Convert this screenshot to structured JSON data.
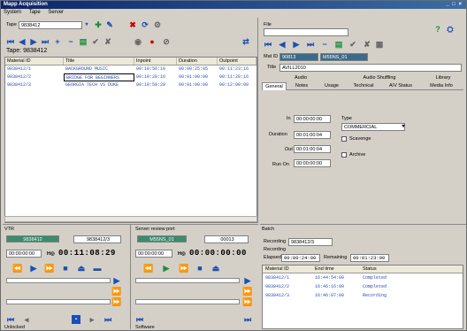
{
  "app": {
    "title": "Mapp Acquisition",
    "window_controls": "_ □ ×"
  },
  "menu": {
    "items": [
      "System",
      "Tape",
      "Server"
    ]
  },
  "left": {
    "tape_label": "Tape",
    "tape_value": "9838412",
    "tape_heading": "Tape: 9838412",
    "columns": [
      "Material ID",
      "Title",
      "Inpoint",
      "Duration",
      "Outpoint"
    ],
    "rows": [
      {
        "id": "9838412/1",
        "title": "BACKGROUND MUSIC",
        "in": "00:10:56:10",
        "dur": "00:00:25:05",
        "out": "00:11:23:16"
      },
      {
        "id": "9838412/2",
        "title": "BRIDGE FOR BEGINNERS",
        "in": "00:10:28:16",
        "dur": "00:01:00:00",
        "out": "00:11:28:16"
      },
      {
        "id": "9838412/3",
        "title": "GEORGIA TECH VS DUKE",
        "in": "00:10:59:29",
        "dur": "00:01:00:00",
        "out": "00:12:00:00"
      }
    ]
  },
  "right": {
    "file_label": "File",
    "mat_id_label": "Mat ID",
    "mat_id_value": "90813",
    "mat_id_side": "M55NS_01",
    "title_label": "Title",
    "title_value": "AVILL2010",
    "tabs_row1": [
      "Audio",
      "Audio Shuffling",
      "Library"
    ],
    "tabs_row2": [
      "General",
      "Notes",
      "Usage",
      "Technical",
      "A/V Status",
      "Media Info"
    ],
    "in_label": "In",
    "in_value": "00:00:00:00",
    "duration_label": "Duration",
    "duration_value": "00:01:00:04",
    "out_label": "Out",
    "out_value": "00:01:00:04",
    "runon_label": "Run On",
    "runon_value": "00:00:00:00",
    "type_label": "Type",
    "type_value": "COMMERCIAL",
    "scavenge_label": "Scavenge",
    "archive_label": "Archive"
  },
  "vtr": {
    "label": "VTR",
    "tape_id": "9838412",
    "mat": "9838412/3",
    "in_tc": "00:00:00:00",
    "timecode": "00:11:08:29"
  },
  "server": {
    "label": "Server review port",
    "left_id": "M55NS_01",
    "right_id": "00013",
    "in_tc": "00:00:00:00",
    "timecode": "00:00:00:00"
  },
  "batch": {
    "label": "Batch",
    "recording_label": "Recording",
    "recording_value": "9838412/3",
    "status_line": "Recording",
    "elapsed_label": "Elapsed",
    "elapsed_value": "00:00:24:00",
    "remaining_label": "Remaining",
    "remaining_value": "00:01:23:00",
    "columns": [
      "Material ID",
      "End time",
      "Status"
    ],
    "rows": [
      {
        "id": "9838412/1",
        "end": "16:44:54:00",
        "status": "Completed"
      },
      {
        "id": "9838412/2",
        "end": "16:46:16:00",
        "status": "Completed"
      },
      {
        "id": "9838412/3",
        "end": "16:46:07:00",
        "status": "Recording"
      }
    ]
  },
  "statusbar": {
    "left": "Unlocked",
    "right": "Software"
  }
}
